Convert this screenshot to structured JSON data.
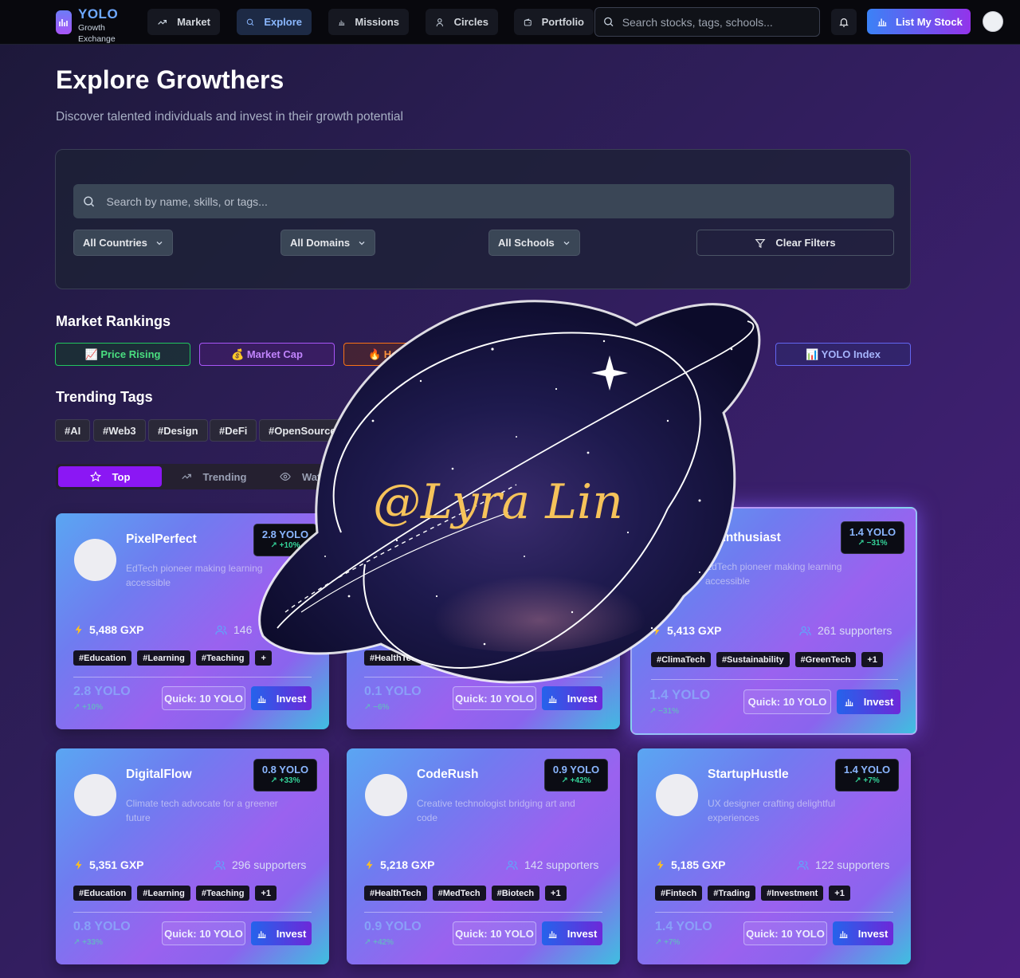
{
  "nav": {
    "logo_title": "YOLO",
    "logo_subtitle_1": "Growth",
    "logo_subtitle_2": "Exchange",
    "items": [
      {
        "label": "Market",
        "icon": "trending-icon"
      },
      {
        "label": "Explore",
        "icon": "search-icon",
        "active": true
      },
      {
        "label": "Missions",
        "icon": "bar-chart-icon"
      },
      {
        "label": "Circles",
        "icon": "user-icon"
      },
      {
        "label": "Portfolio",
        "icon": "wallet-icon"
      }
    ],
    "search_placeholder": "Search stocks, tags, schools...",
    "list_button": "List My Stock"
  },
  "header": {
    "title": "Explore Growthers",
    "subtitle": "Discover talented individuals and invest in their growth potential"
  },
  "filters": {
    "search_placeholder": "Search by name, skills, or tags...",
    "countries": "All Countries",
    "domains": "All Domains",
    "schools": "All Schools",
    "clear": "Clear Filters"
  },
  "rankings": {
    "title": "Market Rankings",
    "buttons": [
      {
        "label": "📈 Price Rising",
        "color": "#4ade80"
      },
      {
        "label": "💰 Market Cap",
        "color": "#c084fc"
      },
      {
        "label": "🔥 Ho",
        "color": "#fb923c"
      },
      {
        "label": "📊 YOLO Index",
        "color": "#a5b4fc"
      }
    ]
  },
  "trending": {
    "title": "Trending Tags",
    "tags": [
      "#AI",
      "#Web3",
      "#Design",
      "#DeFi",
      "#OpenSource"
    ]
  },
  "tabs": {
    "top": "Top",
    "trending": "Trending",
    "watch": "Wat"
  },
  "sticker": {
    "text": "@Lyra Lin"
  },
  "cards": [
    {
      "name": "PixelPerfect",
      "bio": "EdTech pioneer making learning accessible",
      "price": "2.8 YOLO",
      "change": "↗ +10%",
      "gxp": "5,488 GXP",
      "supporters": "146",
      "tags": [
        "#Education",
        "#Learning",
        "#Teaching",
        "+"
      ],
      "quick": "Quick: 10 YOLO",
      "invest": "Invest"
    },
    {
      "name": "",
      "bio": "",
      "price": "0.1 YOLO",
      "change": "↗ −6%",
      "gxp": "",
      "supporters": "",
      "tags": [
        "#HealthTec"
      ],
      "quick": "Quick: 10 YOLO",
      "invest": "Invest"
    },
    {
      "name": "AIEnthusiast",
      "bio": "EdTech pioneer making learning accessible",
      "price": "1.4 YOLO",
      "change": "↗ −31%",
      "gxp": "5,413 GXP",
      "supporters": "261 supporters",
      "tags": [
        "#ClimaTech",
        "#Sustainability",
        "#GreenTech",
        "+1"
      ],
      "quick": "Quick: 10 YOLO",
      "invest": "Invest"
    },
    {
      "name": "DigitalFlow",
      "bio": "Climate tech advocate for a greener future",
      "price": "0.8 YOLO",
      "change": "↗ +33%",
      "gxp": "5,351 GXP",
      "supporters": "296 supporters",
      "tags": [
        "#Education",
        "#Learning",
        "#Teaching",
        "+1"
      ],
      "quick": "Quick: 10 YOLO",
      "invest": "Invest"
    },
    {
      "name": "CodeRush",
      "bio": "Creative technologist bridging art and code",
      "price": "0.9 YOLO",
      "change": "↗ +42%",
      "gxp": "5,218 GXP",
      "supporters": "142 supporters",
      "tags": [
        "#HealthTech",
        "#MedTech",
        "#Biotech",
        "+1"
      ],
      "quick": "Quick: 10 YOLO",
      "invest": "Invest"
    },
    {
      "name": "StartupHustle",
      "bio": "UX designer crafting delightful experiences",
      "price": "1.4 YOLO",
      "change": "↗ +7%",
      "gxp": "5,185 GXP",
      "supporters": "122 supporters",
      "tags": [
        "#Fintech",
        "#Trading",
        "#Investment",
        "+1"
      ],
      "quick": "Quick: 10 YOLO",
      "invest": "Invest"
    }
  ]
}
